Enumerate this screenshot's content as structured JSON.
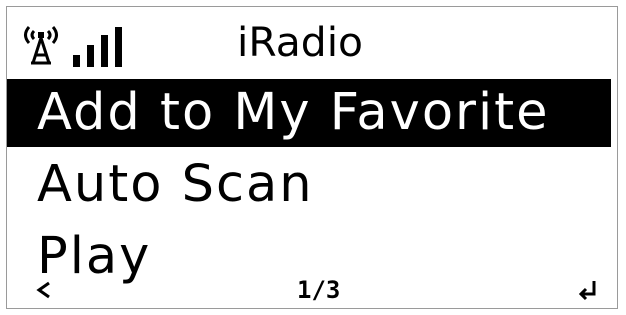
{
  "header": {
    "title": "iRadio",
    "icons": {
      "antenna": "antenna-icon",
      "signal": "signal-strength-icon"
    }
  },
  "menu": {
    "items": [
      {
        "label": "Add to My Favorite",
        "selected": true
      },
      {
        "label": "Auto Scan",
        "selected": false
      },
      {
        "label": "Play",
        "selected": false
      }
    ]
  },
  "footer": {
    "page_indicator": "1/3",
    "back_icon": "back-arrow-icon",
    "enter_icon": "enter-icon"
  },
  "colors": {
    "background": "#ffffff",
    "text": "#000000",
    "selection_background": "#000000",
    "selection_text": "#ffffff",
    "border": "#9a9a9a"
  }
}
